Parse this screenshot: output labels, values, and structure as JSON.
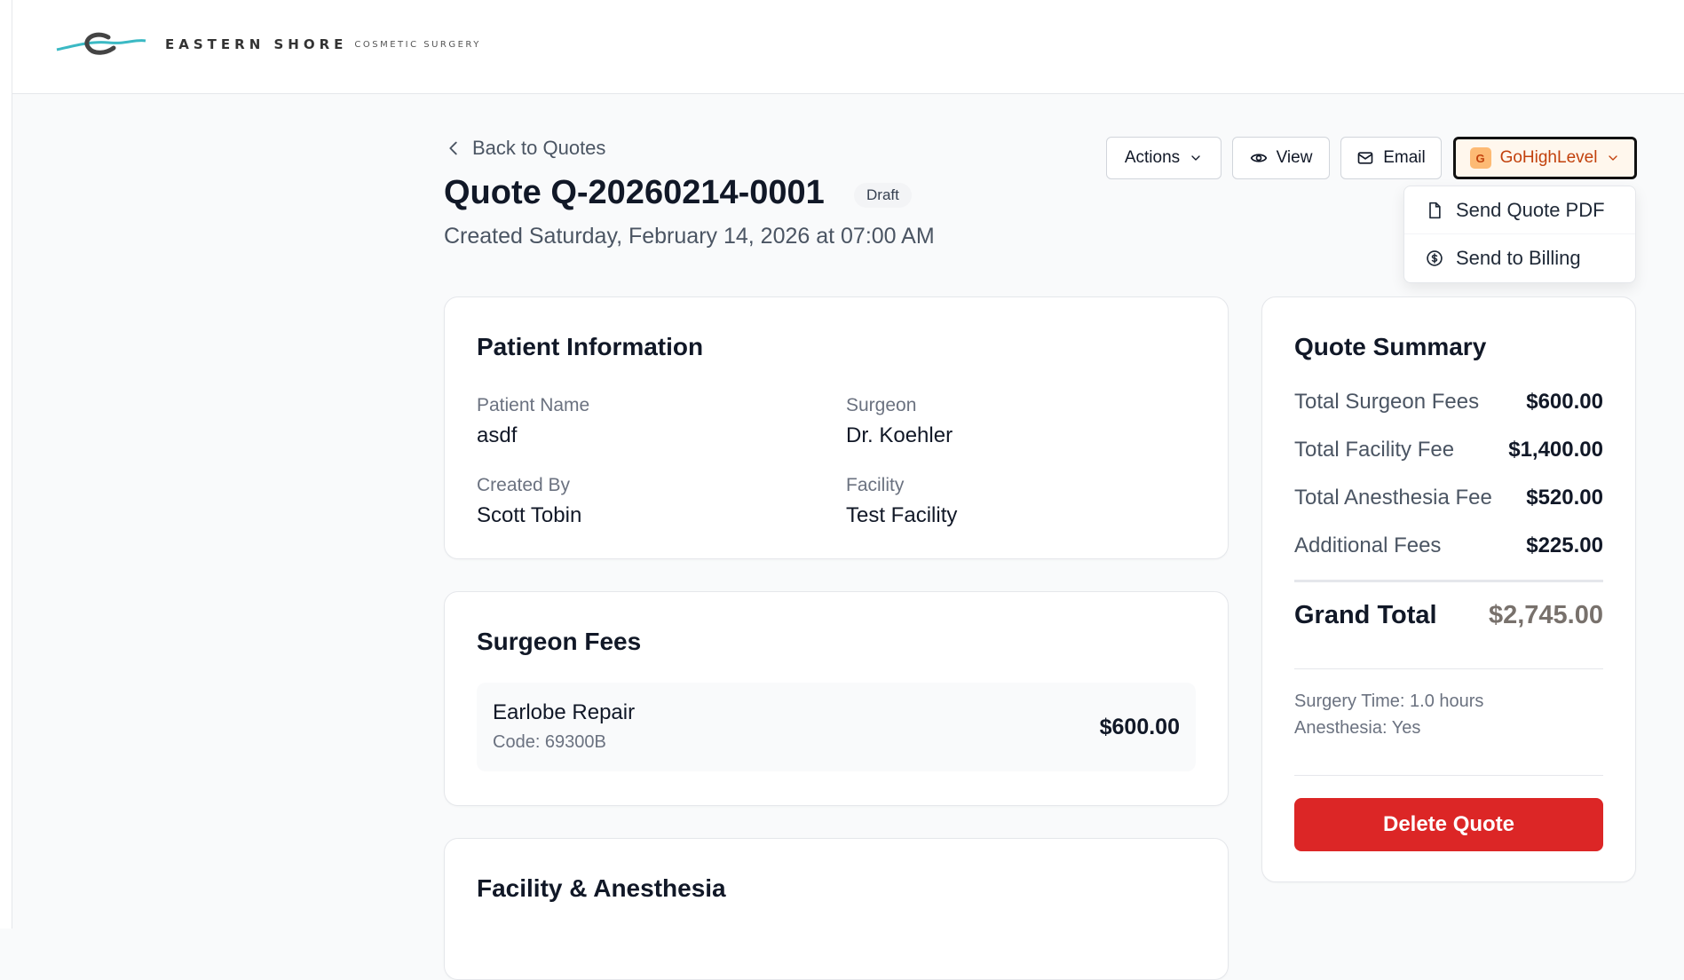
{
  "brand": {
    "name": "EASTERN SHORE",
    "sub": "COSMETIC SURGERY"
  },
  "nav": {
    "back_label": "Back to Quotes"
  },
  "quote": {
    "title": "Quote Q-20260214-0001",
    "status": "Draft",
    "created": "Created Saturday, February 14, 2026 at 07:00 AM"
  },
  "toolbar": {
    "actions": "Actions",
    "view": "View",
    "email": "Email",
    "ghl": "GoHighLevel",
    "ghl_badge": "G"
  },
  "ghl_menu": {
    "send_pdf": "Send Quote PDF",
    "send_billing": "Send to Billing"
  },
  "patient": {
    "title": "Patient Information",
    "patient_name_label": "Patient Name",
    "patient_name": "asdf",
    "surgeon_label": "Surgeon",
    "surgeon": "Dr. Koehler",
    "created_by_label": "Created By",
    "created_by": "Scott Tobin",
    "facility_label": "Facility",
    "facility": "Test Facility"
  },
  "surgeon_fees": {
    "title": "Surgeon Fees",
    "items": [
      {
        "name": "Earlobe Repair",
        "code": "Code: 69300B",
        "amount": "$600.00"
      }
    ]
  },
  "facility_section": {
    "title": "Facility & Anesthesia"
  },
  "summary": {
    "title": "Quote Summary",
    "rows": [
      {
        "label": "Total Surgeon Fees",
        "value": "$600.00"
      },
      {
        "label": "Total Facility Fee",
        "value": "$1,400.00"
      },
      {
        "label": "Total Anesthesia Fee",
        "value": "$520.00"
      },
      {
        "label": "Additional Fees",
        "value": "$225.00"
      }
    ],
    "grand_total_label": "Grand Total",
    "grand_total": "$2,745.00",
    "surgery_time": "Surgery Time: 1.0 hours",
    "anesthesia": "Anesthesia: Yes",
    "delete_label": "Delete Quote"
  },
  "colors": {
    "ghl_accent": "#c2410c",
    "delete": "#dc2626",
    "grand_total": "#78716c"
  }
}
